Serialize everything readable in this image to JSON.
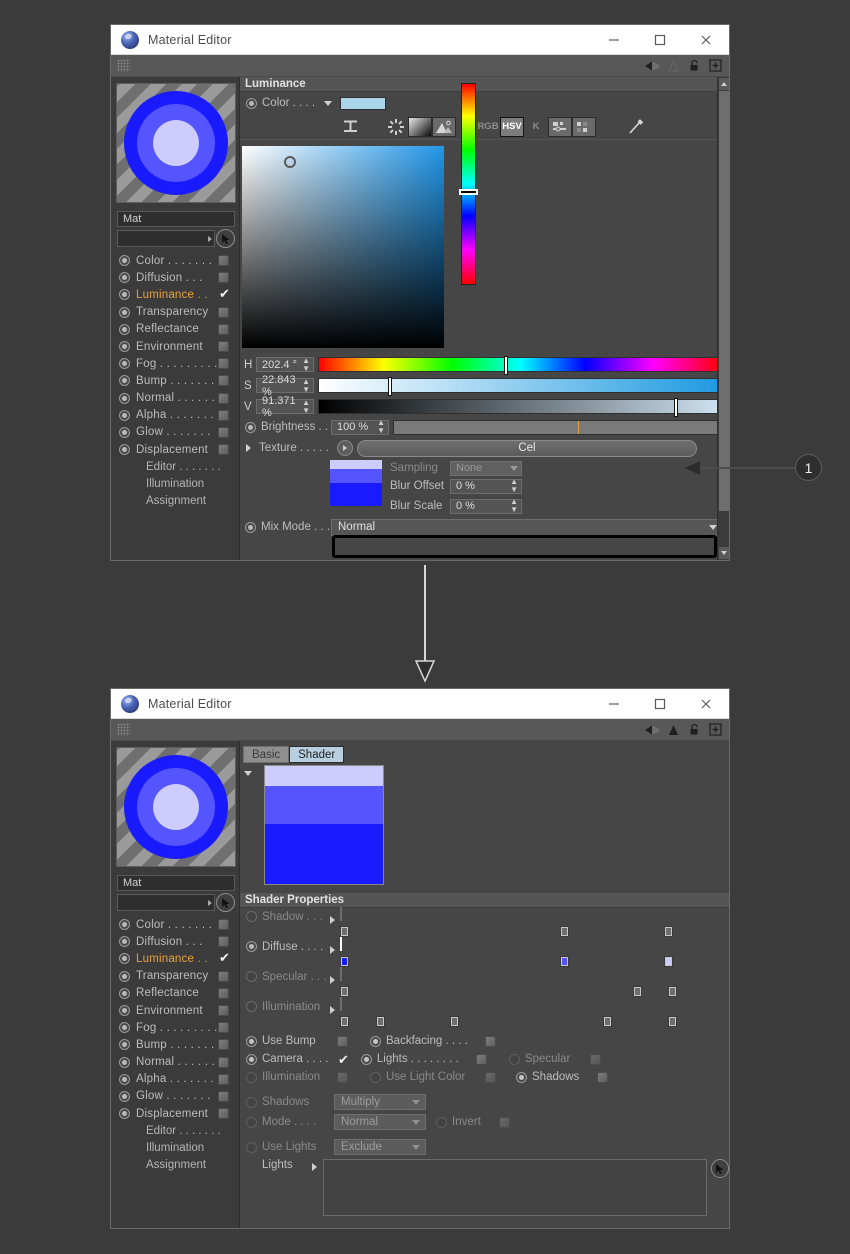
{
  "window_title": "Material Editor",
  "window_buttons": {
    "minimize": "minimize-button",
    "maximize": "maximize-button",
    "close": "close-button"
  },
  "material": {
    "name": "Mat",
    "channels": [
      {
        "label": "Color . . . . . . .",
        "active": false,
        "checked": false
      },
      {
        "label": "Diffusion . . .",
        "active": false,
        "checked": false
      },
      {
        "label": "Luminance . .",
        "active": true,
        "checked": true
      },
      {
        "label": "Transparency",
        "active": false,
        "checked": false
      },
      {
        "label": "Reflectance",
        "active": false,
        "checked": false
      },
      {
        "label": "Environment",
        "active": false,
        "checked": false
      },
      {
        "label": "Fog . . . . . . . . .",
        "active": false,
        "checked": false
      },
      {
        "label": "Bump . . . . . . .",
        "active": false,
        "checked": false
      },
      {
        "label": "Normal . . . . . .",
        "active": false,
        "checked": false
      },
      {
        "label": "Alpha . . . . . . .",
        "active": false,
        "checked": false
      },
      {
        "label": "Glow . . . . . . .",
        "active": false,
        "checked": false
      },
      {
        "label": "Displacement",
        "active": false,
        "checked": false
      }
    ],
    "sub_items": [
      "Editor . . . . . . .",
      "Illumination",
      "Assignment"
    ]
  },
  "top_window": {
    "group_header": "Luminance",
    "color_label": "Color . . . .",
    "color_swatch_hex": "#aad4e8",
    "color_mode_icons": [
      "sliders-icon",
      "color-wheel-icon",
      "gradient-icon",
      "image-icon",
      "rgb-icon",
      "hsv-icon",
      "k-icon",
      "mixer-icon",
      "swatches-icon",
      "eyedropper-icon"
    ],
    "color_mode_labels": {
      "rgb": "RGB",
      "hsv": "HSV",
      "k": "K"
    },
    "active_color_mode": "HSV",
    "hsv": [
      {
        "key": "H",
        "value": "202.4 °"
      },
      {
        "key": "S",
        "value": "22.843 %"
      },
      {
        "key": "V",
        "value": "91.371 %"
      }
    ],
    "brightness_label": "Brightness . .",
    "brightness_value": "100 %",
    "texture_label": "Texture . . . . .",
    "texture_value": "Cel",
    "sampling_label": "Sampling",
    "sampling_value": "None",
    "blur_offset_label": "Blur Offset",
    "blur_offset_value": "0 %",
    "blur_scale_label": "Blur Scale",
    "blur_scale_value": "0 %",
    "mix_mode_label": "Mix Mode . . .",
    "mix_mode_value": "Normal"
  },
  "bottom_window": {
    "tabs": [
      {
        "label": "Basic",
        "selected": false
      },
      {
        "label": "Shader",
        "selected": true
      }
    ],
    "group_header": "Shader Properties",
    "gradient_preview_colors": [
      "#ccccff",
      "#5555ff",
      "#1a1aff"
    ],
    "gradient_rows": [
      {
        "label": "Shadow . . .",
        "enabled": false,
        "active": false
      },
      {
        "label": "Diffuse . . . .",
        "enabled": true,
        "active": true
      },
      {
        "label": "Specular . . .",
        "enabled": false,
        "active": false
      },
      {
        "label": "Illumination",
        "enabled": false,
        "active": false
      }
    ],
    "diffuse_gradient_colors": [
      "#1a1aff",
      "#5555ff",
      "#ccccff"
    ],
    "checkbox_rows": [
      {
        "label": "Use Bump",
        "checked": false,
        "enabled": true
      },
      {
        "label": "Backfacing . . . .",
        "checked": false,
        "enabled": true
      },
      {
        "label": "Camera . . . .",
        "checked": true,
        "enabled": true
      },
      {
        "label": "Lights . . . . . . . .",
        "checked": false,
        "enabled": true
      },
      {
        "label": "Specular",
        "checked": false,
        "enabled": false
      },
      {
        "label": "Illumination",
        "checked": false,
        "enabled": false
      },
      {
        "label": "Use Light Color",
        "checked": false,
        "enabled": false
      },
      {
        "label": "Shadows",
        "checked": false,
        "enabled": true
      }
    ],
    "shadows_label": "Shadows",
    "shadows_value": "Multiply",
    "mode_label": "Mode . . . .",
    "mode_value": "Normal",
    "invert_label": "Invert",
    "use_lights_label": "Use Lights",
    "use_lights_value": "Exclude",
    "lights_label": "Lights",
    "lights_value": ""
  },
  "annotation": {
    "marker": "1",
    "marker_color": "#2e2e2e"
  }
}
